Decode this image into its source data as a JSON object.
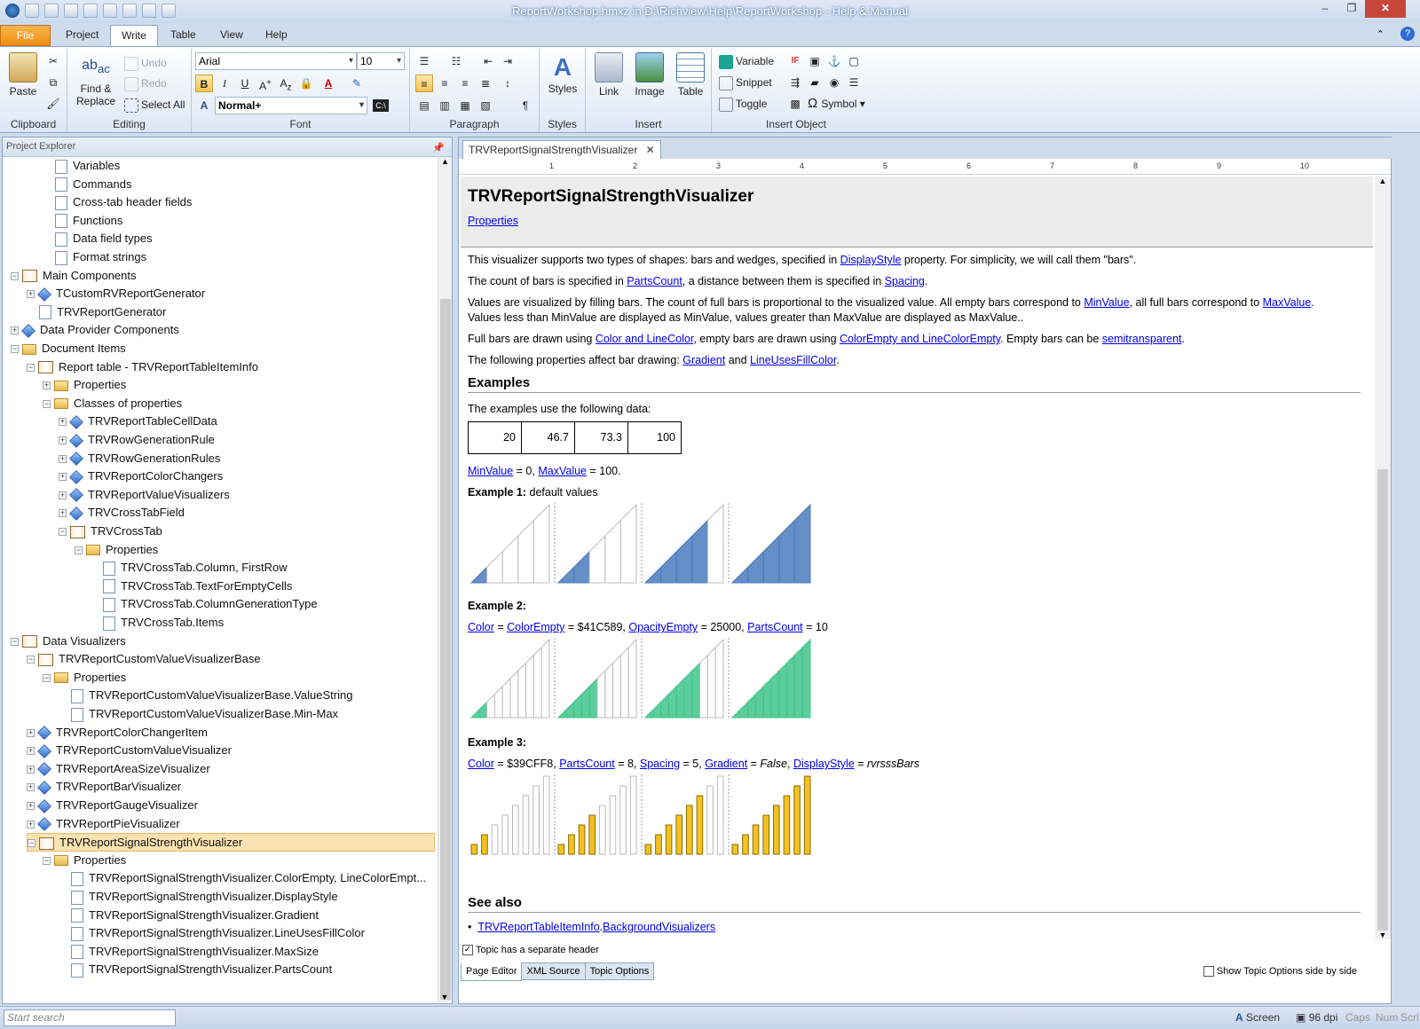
{
  "window": {
    "title": "ReportWorkshop.hmxz in D:\\Richview\\Help\\ReportWorkshop - Help & Manual"
  },
  "ribbon_tabs": [
    "File",
    "Project",
    "Write",
    "Table",
    "View",
    "Help"
  ],
  "ribbon": {
    "clipboard": {
      "paste": "Paste",
      "label": "Clipboard"
    },
    "editing": {
      "find": "Find &",
      "replace": "Replace",
      "undo": "Undo",
      "redo": "Redo",
      "select_all": "Select All",
      "label": "Editing"
    },
    "font": {
      "family": "Arial",
      "size": "10",
      "style": "Normal+",
      "label": "Font"
    },
    "paragraph": {
      "label": "Paragraph"
    },
    "styles": {
      "btn": "Styles",
      "label": "Styles"
    },
    "insert": {
      "link": "Link",
      "image": "Image",
      "table": "Table",
      "label": "Insert"
    },
    "insert_object": {
      "variable": "Variable",
      "snippet": "Snippet",
      "toggle": "Toggle",
      "symbol": "Symbol",
      "label": "Insert Object"
    }
  },
  "explorer": {
    "title": "Project Explorer",
    "items": [
      {
        "label": "Variables",
        "icon": "page"
      },
      {
        "label": "Commands",
        "icon": "page"
      },
      {
        "label": "Cross-tab header fields",
        "icon": "page"
      },
      {
        "label": "Functions",
        "icon": "page"
      },
      {
        "label": "Data field types",
        "icon": "page"
      },
      {
        "label": "Format strings",
        "icon": "page"
      },
      {
        "label": "Main Components",
        "icon": "book"
      },
      {
        "label": "TCustomRVReportGenerator",
        "icon": "cube"
      },
      {
        "label": "TRVReportGenerator",
        "icon": "page"
      },
      {
        "label": "Data Provider Components",
        "icon": "cube"
      },
      {
        "label": "Document Items",
        "icon": "folder"
      },
      {
        "label": "Report table - TRVReportTableItemInfo",
        "icon": "book"
      },
      {
        "label": "Properties",
        "icon": "folder"
      },
      {
        "label": "Classes of properties",
        "icon": "folder"
      },
      {
        "label": "TRVReportTableCellData",
        "icon": "cube"
      },
      {
        "label": "TRVRowGenerationRule",
        "icon": "cube"
      },
      {
        "label": "TRVRowGenerationRules",
        "icon": "cube"
      },
      {
        "label": "TRVReportColorChangers",
        "icon": "cube"
      },
      {
        "label": "TRVReportValueVisualizers",
        "icon": "cube"
      },
      {
        "label": "TRVCrossTabField",
        "icon": "cube"
      },
      {
        "label": "TRVCrossTab",
        "icon": "book"
      },
      {
        "label": "Properties",
        "icon": "folder"
      },
      {
        "label": "TRVCrossTab.Column, FirstRow",
        "icon": "page"
      },
      {
        "label": "TRVCrossTab.TextForEmptyCells",
        "icon": "page"
      },
      {
        "label": "TRVCrossTab.ColumnGenerationType",
        "icon": "page"
      },
      {
        "label": "TRVCrossTab.Items",
        "icon": "page"
      },
      {
        "label": "Data Visualizers",
        "icon": "book"
      },
      {
        "label": "TRVReportCustomValueVisualizerBase",
        "icon": "book"
      },
      {
        "label": "Properties",
        "icon": "folder"
      },
      {
        "label": "TRVReportCustomValueVisualizerBase.ValueString",
        "icon": "page"
      },
      {
        "label": "TRVReportCustomValueVisualizerBase.Min-Max",
        "icon": "page"
      },
      {
        "label": "TRVReportColorChangerItem",
        "icon": "cube"
      },
      {
        "label": "TRVReportCustomValueVisualizer",
        "icon": "cube"
      },
      {
        "label": "TRVReportAreaSizeVisualizer",
        "icon": "cube"
      },
      {
        "label": "TRVReportBarVisualizer",
        "icon": "cube"
      },
      {
        "label": "TRVReportGaugeVisualizer",
        "icon": "cube"
      },
      {
        "label": "TRVReportPieVisualizer",
        "icon": "cube"
      },
      {
        "label": "TRVReportSignalStrengthVisualizer",
        "icon": "book"
      },
      {
        "label": "Properties",
        "icon": "folder"
      },
      {
        "label": "TRVReportSignalStrengthVisualizer.ColorEmpty, LineColorEmpt...",
        "icon": "page"
      },
      {
        "label": "TRVReportSignalStrengthVisualizer.DisplayStyle",
        "icon": "page"
      },
      {
        "label": "TRVReportSignalStrengthVisualizer.Gradient",
        "icon": "page"
      },
      {
        "label": "TRVReportSignalStrengthVisualizer.LineUsesFillColor",
        "icon": "page"
      },
      {
        "label": "TRVReportSignalStrengthVisualizer.MaxSize",
        "icon": "page"
      },
      {
        "label": "TRVReportSignalStrengthVisualizer.PartsCount",
        "icon": "page"
      }
    ],
    "selected": "TRVReportSignalStrengthVisualizer"
  },
  "editor": {
    "tab": "TRVReportSignalStrengthVisualizer",
    "ruler": [
      "1",
      "2",
      "3",
      "4",
      "5",
      "6",
      "7",
      "8",
      "9",
      "10"
    ],
    "title": "TRVReportSignalStrengthVisualizer",
    "properties_link": "Properties",
    "p1a": "This visualizer supports two types of shapes: bars and wedges, specified in ",
    "p1link": "DisplayStyle",
    "p1b": " property. For simplicity, we will call them \"bars\".",
    "p2a": "The count of bars is specified in ",
    "p2link1": "PartsCount",
    "p2b": ", a distance between them is specified in ",
    "p2link2": "Spacing",
    "p2c": ".",
    "p3a": "Values are visualized by filling bars. The count of full bars is proportional to the visualized value. All empty bars correspond to ",
    "p3link1": "MinValue",
    "p3b": ", all full bars correspond to ",
    "p3link2": "MaxValue",
    "p3c": ".",
    "p3d": "Values less than MinValue are displayed as MinValue, values greater than MaxValue are displayed as MaxValue..",
    "p4a": "Full bars are drawn using ",
    "p4link1": "Color and LineColor",
    "p4b": ", empty bars are drawn using ",
    "p4link2": "ColorEmpty and LineColorEmpty",
    "p4c": ". Empty bars can be ",
    "p4link3": "semitransparent",
    "p4d": ".",
    "p5a": "The following properties affect bar drawing: ",
    "p5link1": "Gradient",
    "p5b": " and ",
    "p5link2": "LineUsesFillColor",
    "p5c": ".",
    "examples_heading": "Examples",
    "examples_intro": "The examples use the following data:",
    "data_values": [
      "20",
      "46.7",
      "73.3",
      "100"
    ],
    "minmax_link1": "MinValue",
    "minmax_a": " = 0, ",
    "minmax_link2": "MaxValue",
    "minmax_b": " = 100.",
    "ex1_label": "Example 1:",
    "ex1_desc": " default values",
    "ex2_label": "Example 2:",
    "ex2_link1": "Color",
    "ex2_a": " = ",
    "ex2_link2": "ColorEmpty",
    "ex2_b": " = $41C589, ",
    "ex2_link3": "OpacityEmpty",
    "ex2_c": " = 25000, ",
    "ex2_link4": "PartsCount",
    "ex2_d": " = 10",
    "ex3_label": "Example 3:",
    "ex3_link1": "Color",
    "ex3_a": " = $39CFF8, ",
    "ex3_link2": "PartsCount",
    "ex3_b": " = 8, ",
    "ex3_link3": "Spacing",
    "ex3_c": " = 5, ",
    "ex3_link4": "Gradient",
    "ex3_d": " = ",
    "ex3_false": "False",
    "ex3_e": ", ",
    "ex3_link5": "DisplayStyle",
    "ex3_f": " = ",
    "ex3_val": "rvrsssBars",
    "seealso_heading": "See also",
    "seealso_link1": "TRVReportTableItemInfo",
    "seealso_dot": ".",
    "seealso_link2": "BackgroundVisualizers",
    "separate_header": "Topic has a separate header",
    "bottom_tabs": [
      "Page Editor",
      "XML Source",
      "Topic Options"
    ],
    "show_side": "Show Topic Options side by side"
  },
  "visual_examples": {
    "values": [
      20,
      46.7,
      73.3,
      100
    ],
    "min": 0,
    "max": 100,
    "ex1": {
      "parts": 5,
      "color": "#4a7bbd"
    },
    "ex2": {
      "parts": 10,
      "color": "#41c589"
    },
    "ex3": {
      "parts": 8,
      "color": "#f3c121"
    }
  },
  "status": {
    "search_placeholder": "Start search",
    "screen": "Screen",
    "dpi": "96 dpi",
    "caps": "Caps",
    "num": "Num",
    "scrl": "Scrl"
  }
}
